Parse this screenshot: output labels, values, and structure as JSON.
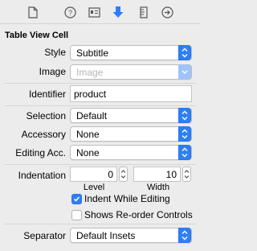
{
  "toolbar": {
    "tabs": [
      {
        "icon": "file-icon"
      },
      {
        "icon": "help-icon"
      },
      {
        "icon": "identity-icon"
      },
      {
        "icon": "attributes-icon",
        "selected": true
      },
      {
        "icon": "ruler-icon"
      },
      {
        "icon": "connections-icon"
      }
    ],
    "accent": "#2d7ff9"
  },
  "section": {
    "title": "Table View Cell"
  },
  "fields": {
    "style": {
      "label": "Style",
      "value": "Subtitle"
    },
    "image": {
      "label": "Image",
      "placeholder": "Image"
    },
    "identifier": {
      "label": "Identifier",
      "value": "product"
    },
    "selection": {
      "label": "Selection",
      "value": "Default"
    },
    "accessory": {
      "label": "Accessory",
      "value": "None"
    },
    "editing_acc": {
      "label": "Editing Acc.",
      "value": "None"
    },
    "indentation": {
      "label": "Indentation",
      "level": {
        "value": "0",
        "label": "Level"
      },
      "width": {
        "value": "10",
        "label": "Width"
      }
    },
    "indent_while_editing": {
      "label": "Indent While Editing",
      "checked": true
    },
    "show_reorder": {
      "label": "Shows Re-order Controls",
      "checked": false
    },
    "separator": {
      "label": "Separator",
      "value": "Default Insets"
    }
  }
}
